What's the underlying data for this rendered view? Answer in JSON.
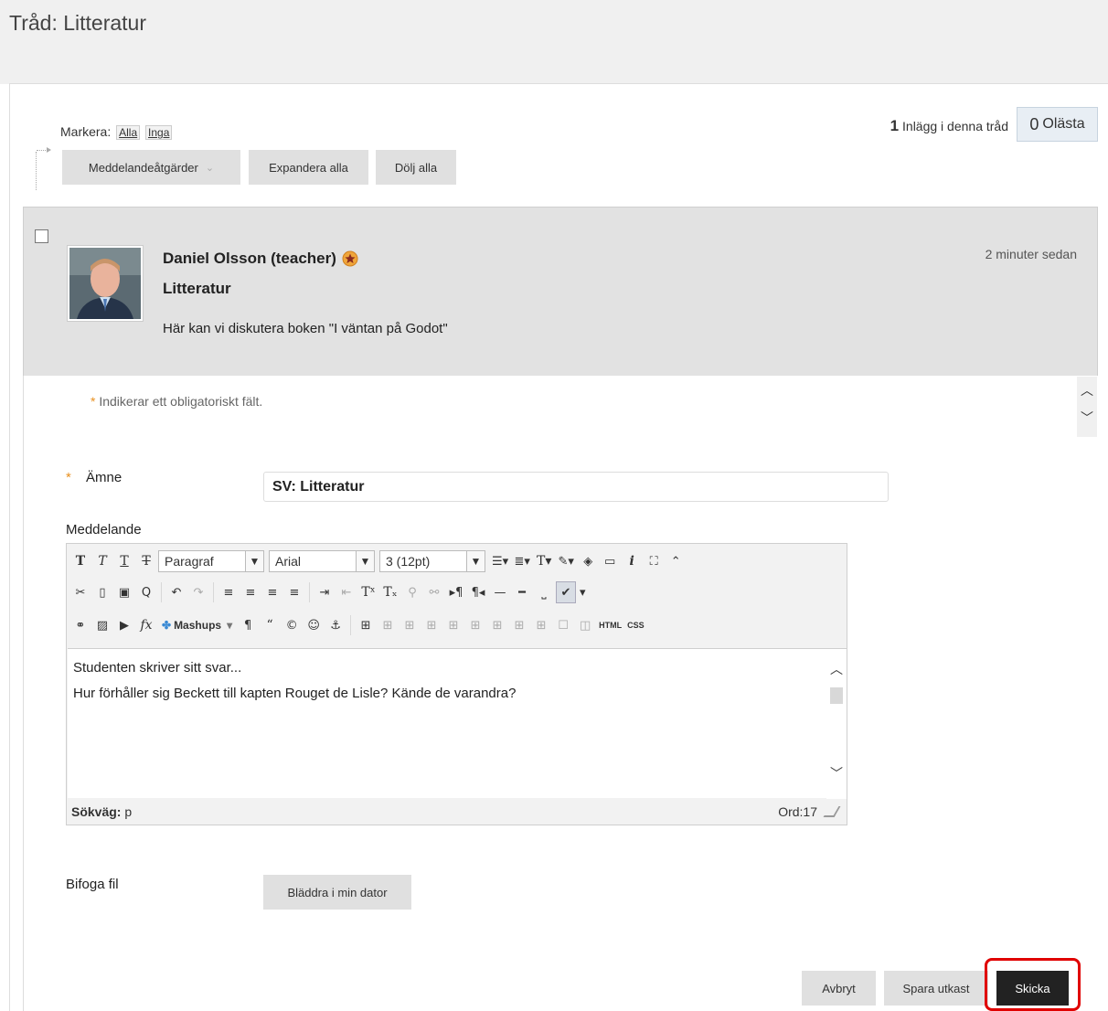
{
  "page": {
    "title": "Tråd: Litteratur"
  },
  "select": {
    "label": "Markera:",
    "all": "Alla",
    "none": "Inga"
  },
  "toolbar": {
    "message_actions": "Meddelandeåtgärder",
    "expand_all": "Expandera alla",
    "collapse_all": "Dölj alla"
  },
  "thread_stats": {
    "post_count": "1",
    "post_count_label": "Inlägg i denna tråd",
    "unread_count": "0",
    "unread_label": "Olästa"
  },
  "post": {
    "author": "Daniel Olsson (teacher)",
    "subject": "Litteratur",
    "body": "Här kan vi diskutera boken \"I väntan på Godot\"",
    "time": "2 minuter sedan"
  },
  "form": {
    "required_note": "Indikerar ett obligatoriskt fält.",
    "required_mark": "*",
    "subject_label": "Ämne",
    "subject_value": "SV: Litteratur",
    "message_label": "Meddelande",
    "attach_label": "Bifoga fil",
    "browse_button": "Bläddra i min dator",
    "cancel_button": "Avbryt",
    "draft_button": "Spara utkast",
    "submit_button": "Skicka"
  },
  "editor": {
    "format_select": "Paragraf",
    "font_select": "Arial",
    "size_select": "3 (12pt)",
    "mashups": "Mashups",
    "html_button": "HTML",
    "css_button": "CSS",
    "content_lines": [
      "Studenten skriver sitt svar...",
      "Hur förhåller sig Beckett till kapten Rouget de Lisle? Kände de varandra?"
    ],
    "path_label": "Sökväg:",
    "path_value": "p",
    "word_count": "Ord:17"
  },
  "colors": {
    "accent_star": "#e8901f",
    "highlight": "#e00000",
    "submit_bg": "#222222"
  }
}
